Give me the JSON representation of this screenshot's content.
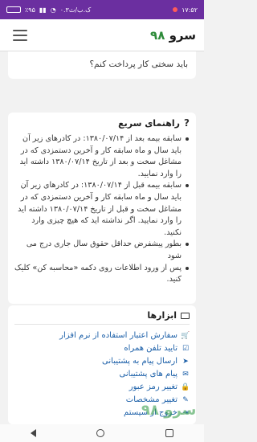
{
  "status_bar": {
    "time": "۱۷:۵۲",
    "network": "۰.۳ک.ب/ث",
    "battery": "٪۹۵"
  },
  "header": {
    "logo_text": "سرو",
    "logo_number": "۹۸"
  },
  "question_card": {
    "text": "باید سختی کار پرداخت کنم؟"
  },
  "guide": {
    "title": "راهنمای سریع",
    "items": [
      "سابقه بیمه بعد از ۱۳۸۰/۰۷/۱۴: در کادرهای زیر آن باید سال و ماه سابقه کار و آخرین دستمزدی که در مشاغل سخت و بعد از تاریخ ۱۳۸۰/۰۷/۱۴ داشته اید را وارد نمایید.",
      "سابقه بیمه قبل از ۱۳۸۰/۰۷/۱۴: در کادرهای زیر آن باید سال و ماه سابقه کار و آخرین دستمزدی که در مشاغل سخت و قبل از تاریخ ۱۳۸۰/۰۷/۱۴ داشته اید را وارد نمایید. اگر نداشته اید که هیچ چیزی وارد نکنید.",
      "بطور پیشفرض حداقل حقوق سال جاری درج می شود",
      "پس از ورود اطلاعات روی دکمه «محاسبه کن» کلیک کنید."
    ]
  },
  "tools": {
    "title": "ابزارها",
    "items": [
      {
        "label": "سفارش اعتبار استفاده از نرم افزار",
        "icon": "cart-icon"
      },
      {
        "label": "تایید تلفن همراه",
        "icon": "check-square-icon"
      },
      {
        "label": "ارسال پیام به پشتیبانی",
        "icon": "send-icon"
      },
      {
        "label": "پیام های پشتیبانی",
        "icon": "chat-icon"
      },
      {
        "label": "تغییر رمز عبور",
        "icon": "lock-icon"
      },
      {
        "label": "تغییر مشخصات",
        "icon": "edit-icon"
      },
      {
        "label": "خروج از سیستم",
        "icon": "logout-icon"
      }
    ]
  },
  "watermark": "سرو ۹۸",
  "colors": {
    "status_bar": "#6b2fa0",
    "link": "#1b5fa8",
    "logo_accent": "#2e8b3a"
  }
}
